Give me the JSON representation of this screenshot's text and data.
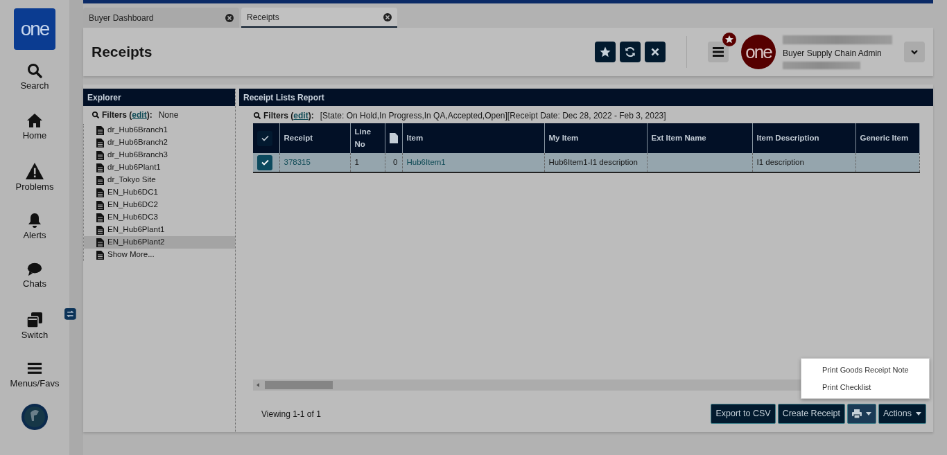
{
  "sidebar": {
    "logo": "one",
    "items": [
      {
        "label": "Search",
        "kind": "search"
      },
      {
        "label": "Home",
        "kind": "home"
      },
      {
        "label": "Problems",
        "kind": "problems"
      },
      {
        "label": "Alerts",
        "kind": "alerts"
      },
      {
        "label": "Chats",
        "kind": "chats"
      },
      {
        "label": "Switch",
        "kind": "switch"
      },
      {
        "label": "Menus/Favs",
        "kind": "menus"
      }
    ]
  },
  "tabs": [
    {
      "label": "Buyer Dashboard",
      "selected": false
    },
    {
      "label": "Receipts",
      "selected": true
    }
  ],
  "header": {
    "title": "Receipts",
    "user_logo": "one",
    "user_role": "Buyer Supply Chain Admin"
  },
  "explorer": {
    "title": "Explorer",
    "filters_label": "Filters (",
    "edit_link": "edit",
    "filters_label_end": "):",
    "filters_value": "None",
    "items": [
      {
        "label": "dr_Hub6Branch1",
        "selected": false
      },
      {
        "label": "dr_Hub6Branch2",
        "selected": false
      },
      {
        "label": "dr_Hub6Branch3",
        "selected": false
      },
      {
        "label": "dr_Hub6Plant1",
        "selected": false
      },
      {
        "label": "dr_Tokyo Site",
        "selected": false
      },
      {
        "label": "EN_Hub6DC1",
        "selected": false
      },
      {
        "label": "EN_Hub6DC2",
        "selected": false
      },
      {
        "label": "EN_Hub6DC3",
        "selected": false
      },
      {
        "label": "EN_Hub6Plant1",
        "selected": false
      },
      {
        "label": "EN_Hub6Plant2",
        "selected": true
      },
      {
        "label": "Show More...",
        "selected": false
      }
    ]
  },
  "report": {
    "title": "Receipt Lists Report",
    "filters_label": "Filters (",
    "edit_link": "edit",
    "filters_label_end": "):",
    "filters_value": "[State: On Hold,In Progress,In QA,Accepted,Open][Receipt Date: Dec 28, 2022 - Feb 3, 2023]",
    "header_checkbox": {
      "checked": true
    },
    "columns": [
      {
        "kind": "text",
        "label": "Receipt"
      },
      {
        "kind": "text",
        "label": "Line No"
      },
      {
        "kind": "icon"
      },
      {
        "kind": "text",
        "label": "Item"
      },
      {
        "kind": "text",
        "label": "My Item"
      },
      {
        "kind": "text",
        "label": "Ext Item Name"
      },
      {
        "kind": "text",
        "label": "Item Description"
      },
      {
        "kind": "text",
        "label": "Generic Item"
      }
    ],
    "rows": [
      {
        "selected": true,
        "cells": [
          "378315",
          "1",
          "0",
          "Hub6Item1",
          "Hub6Item1-I1 description",
          null,
          "I1 description",
          null
        ]
      }
    ],
    "viewing": "Viewing 1-1 of 1",
    "buttons": [
      {
        "kind": "text",
        "label": "Export to CSV"
      },
      {
        "kind": "text",
        "label": "Create Receipt"
      },
      {
        "kind": "print",
        "expanded": true
      },
      {
        "kind": "dropdown",
        "label": "Actions",
        "expanded": false
      }
    ],
    "print_menu": [
      "Print Goods Receipt Note",
      "Print Checklist"
    ]
  }
}
